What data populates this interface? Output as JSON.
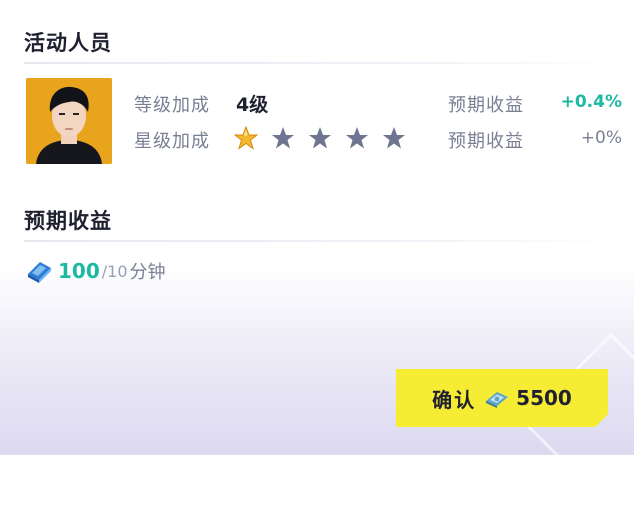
{
  "sections": {
    "active_personnel_title": "活动人员",
    "expected_income_title": "预期收益"
  },
  "personnel": {
    "level_bonus_label": "等级加成",
    "level_value": "4级",
    "star_bonus_label": "星级加成",
    "stars_filled": 1,
    "stars_total": 5,
    "expected_income_label_1": "预期收益",
    "expected_income_value_1": "+0.4%",
    "expected_income_label_2": "预期收益",
    "expected_income_value_2": "+0%"
  },
  "reward": {
    "icon": "book-icon",
    "amount": "100",
    "rate_text": "/10",
    "unit": "分钟"
  },
  "confirm_button": {
    "label": "确认",
    "icon": "currency-icon",
    "cost": "5500"
  },
  "colors": {
    "accent_green": "#1db9a3",
    "button_yellow": "#f6ec34",
    "star_gold": "#f5b82e",
    "star_gray": "#6e7590"
  }
}
